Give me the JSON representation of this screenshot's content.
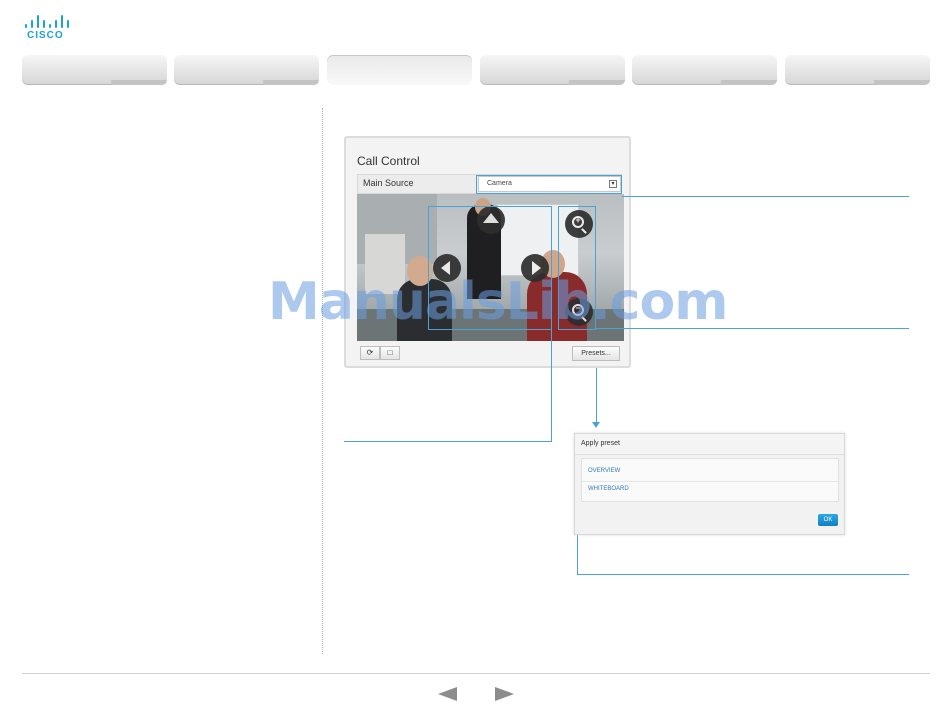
{
  "brand": {
    "name": "CISCO",
    "color": "#1ba0d7"
  },
  "tabs": [
    {
      "label": "",
      "active": false
    },
    {
      "label": "",
      "active": false
    },
    {
      "label": "",
      "active": true
    },
    {
      "label": "",
      "active": false
    },
    {
      "label": "",
      "active": false
    },
    {
      "label": "",
      "active": false
    }
  ],
  "call_control": {
    "title": "Call Control",
    "main_source_label": "Main Source",
    "main_source_value": "Camera",
    "controls": {
      "refresh_icon": "refresh-icon",
      "stop_icon": "square-icon",
      "presets_label": "Presets..."
    },
    "camera_nav_icons": [
      "arrow-up-icon",
      "arrow-left-icon",
      "arrow-right-icon",
      "zoom-in-icon",
      "zoom-out-icon"
    ]
  },
  "apply_preset": {
    "title": "Apply preset",
    "presets": [
      "OVERVIEW",
      "WHITEBOARD"
    ],
    "ok_label": "OK"
  },
  "watermark": "ManualsLib.com",
  "footer": {
    "prev_icon": "previous-page-icon",
    "next_icon": "next-page-icon"
  },
  "colors": {
    "callout": "#4aa3d4",
    "ok_button": "#1a8fd5",
    "preset_link": "#2e79b7"
  }
}
